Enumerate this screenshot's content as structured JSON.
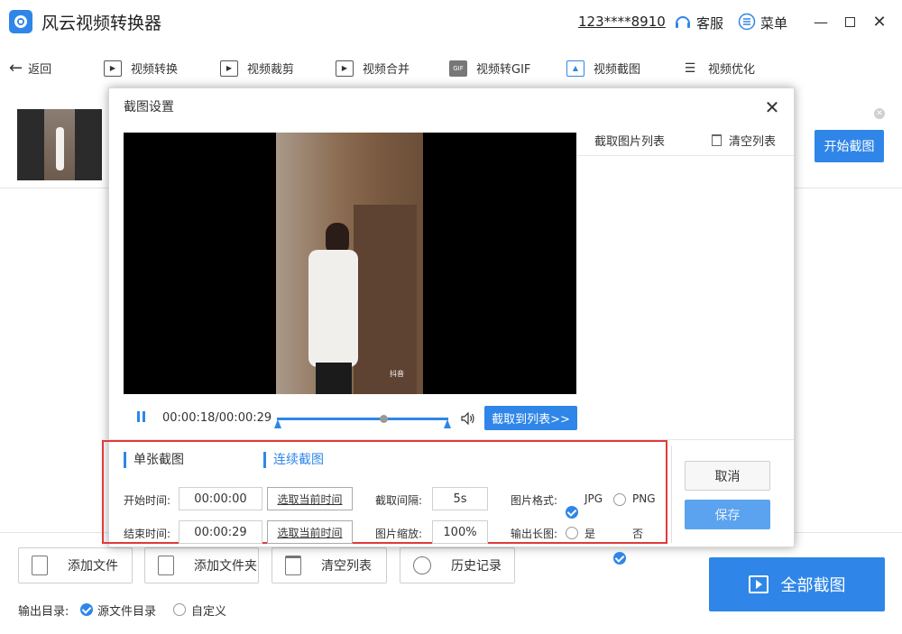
{
  "app": {
    "title": "风云视频转换器",
    "account": "123****8910",
    "service": "客服",
    "menu": "菜单"
  },
  "toolbar": {
    "back": "返回",
    "items": [
      {
        "label": "视频转换",
        "icon": "video-convert-icon"
      },
      {
        "label": "视频裁剪",
        "icon": "video-crop-icon"
      },
      {
        "label": "视频合并",
        "icon": "video-merge-icon"
      },
      {
        "label": "视频转GIF",
        "icon": "gif-icon"
      },
      {
        "label": "视频截图",
        "icon": "screenshot-icon"
      },
      {
        "label": "视频优化",
        "icon": "optimize-icon"
      }
    ]
  },
  "list": {
    "start_button": "开始截图"
  },
  "bottom": {
    "add_file": "添加文件",
    "add_folder": "添加文件夹",
    "clear_list": "清空列表",
    "history": "历史记录",
    "all_capture": "全部截图",
    "output_dir_label": "输出目录:",
    "output_source": "源文件目录",
    "output_custom": "自定义",
    "output_selected": "源文件目录"
  },
  "dialog": {
    "title": "截图设置",
    "list_title": "截取图片列表",
    "clear_list": "清空列表",
    "watermark": "抖音",
    "timecode": "00:00:18/00:00:29",
    "progress": 0.62,
    "capture_to_list": "截取到列表>>",
    "tabs": {
      "single": "单张截图",
      "continuous": "连续截图"
    },
    "start_time_label": "开始时间:",
    "start_time": "00:00:00",
    "end_time_label": "结束时间:",
    "end_time": "00:00:29",
    "pick_current": "选取当前时间",
    "interval_label": "截取间隔:",
    "interval": "5s",
    "scale_label": "图片缩放:",
    "scale": "100%",
    "format_label": "图片格式:",
    "format_jpg": "JPG",
    "format_png": "PNG",
    "format_selected": "JPG",
    "long_label": "输出长图:",
    "long_yes": "是",
    "long_no": "否",
    "long_selected": "否",
    "cancel": "取消",
    "save": "保存"
  },
  "colors": {
    "accent": "#2f86e8",
    "highlight": "#e03a3a"
  }
}
